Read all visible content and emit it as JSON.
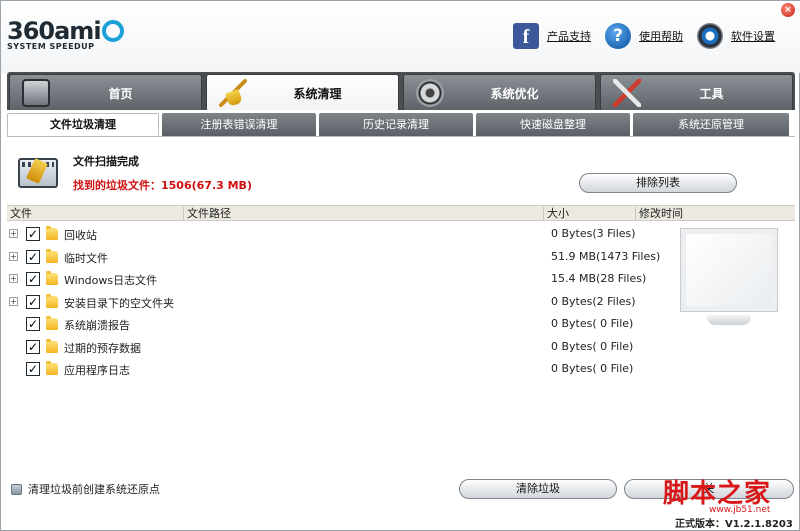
{
  "app": {
    "brand_num": "360",
    "brand_word": "ami",
    "brand_tag": "SYSTEM SPEEDUP"
  },
  "toplinks": {
    "support": "产品支持",
    "help": "使用帮助",
    "settings": "软件设置"
  },
  "maintabs": [
    {
      "label": "首页",
      "icon": "home-icon"
    },
    {
      "label": "系统清理",
      "icon": "broom-icon"
    },
    {
      "label": "系统优化",
      "icon": "gears-icon"
    },
    {
      "label": "工具",
      "icon": "tools-icon"
    }
  ],
  "subtabs": [
    {
      "label": "文件垃圾清理"
    },
    {
      "label": "注册表错误清理"
    },
    {
      "label": "历史记录清理"
    },
    {
      "label": "快速磁盘整理"
    },
    {
      "label": "系统还原管理"
    }
  ],
  "status": {
    "title": "文件扫描完成",
    "found": "找到的垃圾文件：1506(67.3 MB)",
    "sort_button": "排除列表"
  },
  "table": {
    "headers": {
      "name": "文件",
      "path": "文件路径",
      "size": "大小",
      "modified": "修改时间"
    },
    "rows": [
      {
        "name": "回收站",
        "size": "0 Bytes(3 Files)",
        "expandable": true
      },
      {
        "name": "临时文件",
        "size": "51.9 MB(1473 Files)",
        "expandable": true
      },
      {
        "name": "Windows日志文件",
        "size": "15.4 MB(28 Files)",
        "expandable": true
      },
      {
        "name": "安装目录下的空文件夹",
        "size": "0 Bytes(2 Files)",
        "expandable": true
      },
      {
        "name": "系统崩溃报告",
        "size": "0 Bytes( 0 File)",
        "expandable": false
      },
      {
        "name": "过期的预存数据",
        "size": "0 Bytes( 0 File)",
        "expandable": false
      },
      {
        "name": "应用程序日志",
        "size": "0 Bytes( 0 File)",
        "expandable": false
      }
    ]
  },
  "footer": {
    "restore_label": "清理垃圾前创建系统还原点",
    "clean_button": "清除垃圾",
    "cancel_button": "关",
    "version": "正式版本：V1.2.1.8203"
  },
  "watermark": {
    "text": "脚本之家",
    "sub": "www.jb51.net"
  }
}
